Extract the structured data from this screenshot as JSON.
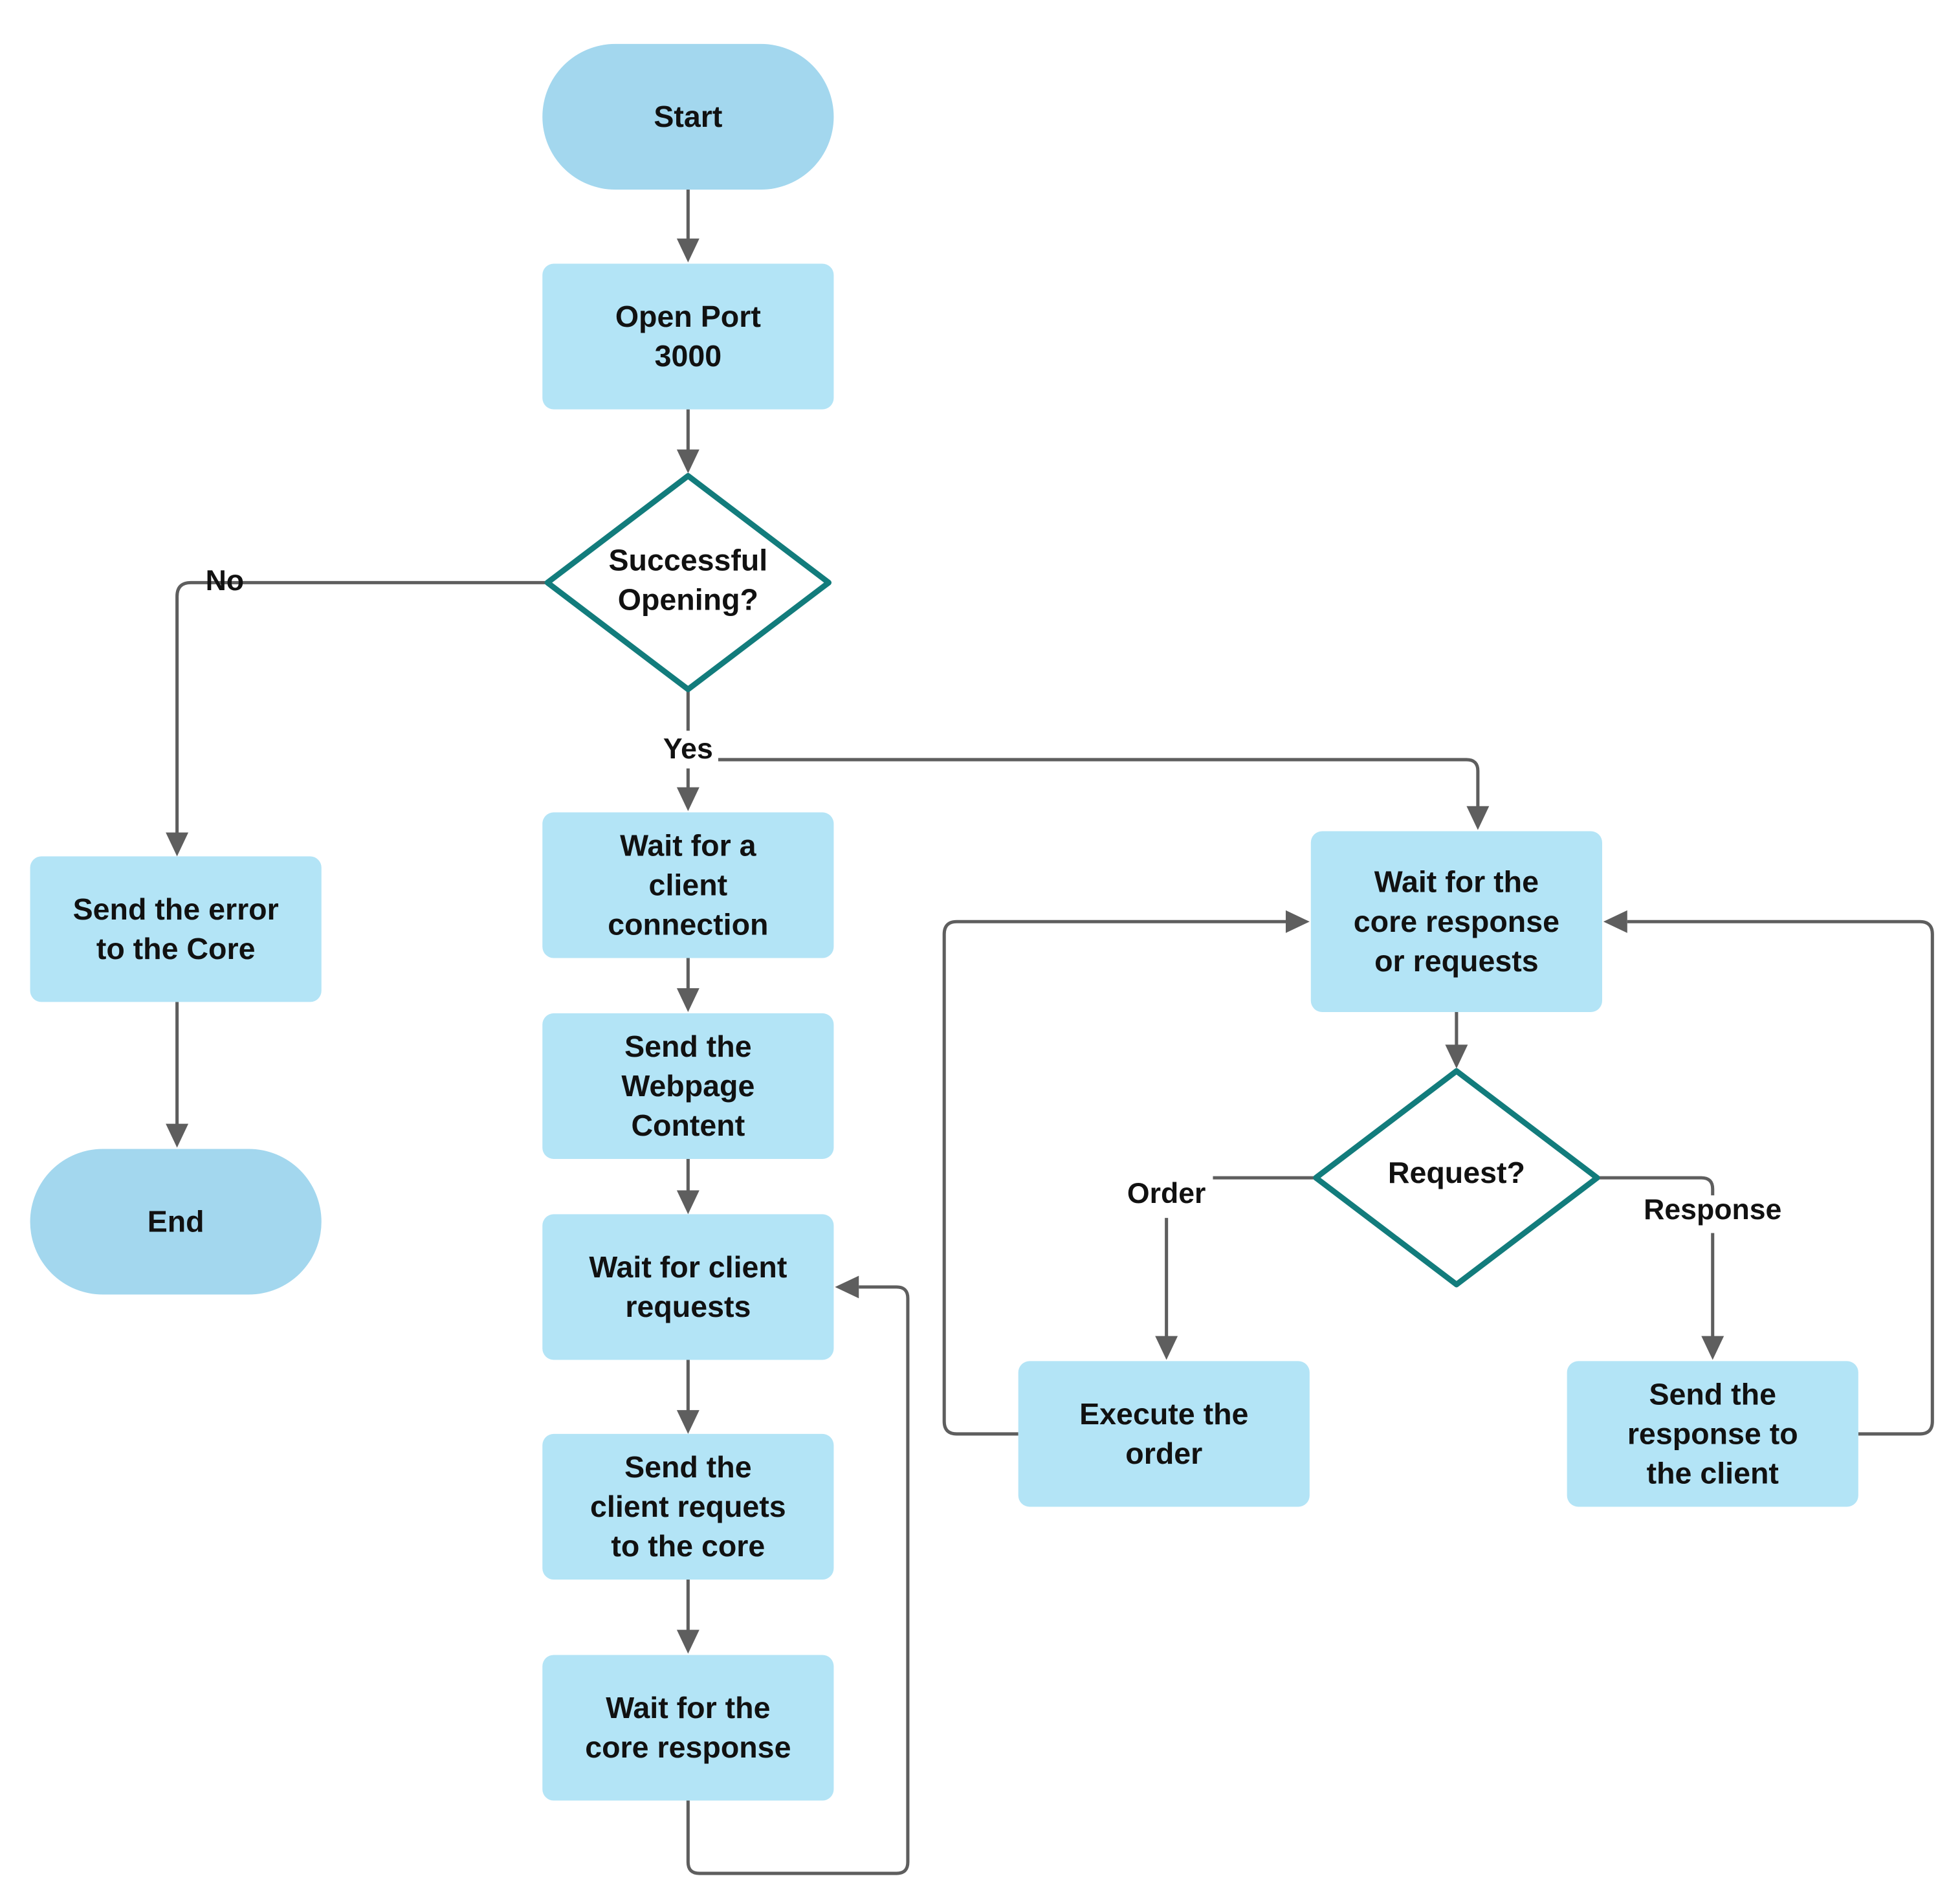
{
  "diagram": {
    "type": "flowchart",
    "colors": {
      "terminal_fill": "#a3d7ee",
      "process_fill": "#b3e4f6",
      "decision_stroke": "#127c7c",
      "decision_fill": "#ffffff",
      "edge": "#5e5e5e",
      "text": "#111111"
    },
    "nodes": [
      {
        "id": "start",
        "kind": "terminal",
        "lines": [
          "Start"
        ]
      },
      {
        "id": "open-port",
        "kind": "process",
        "lines": [
          "Open Port",
          "3000"
        ]
      },
      {
        "id": "successful-opening",
        "kind": "decision",
        "lines": [
          "Successful",
          "Opening?"
        ]
      },
      {
        "id": "send-error",
        "kind": "process",
        "lines": [
          "Send the error",
          "to the Core"
        ]
      },
      {
        "id": "end",
        "kind": "terminal",
        "lines": [
          "End"
        ]
      },
      {
        "id": "wait-client-connection",
        "kind": "process",
        "lines": [
          "Wait for a",
          "client",
          "connection"
        ]
      },
      {
        "id": "send-webpage",
        "kind": "process",
        "lines": [
          "Send the",
          "Webpage",
          "Content"
        ]
      },
      {
        "id": "wait-client-requests",
        "kind": "process",
        "lines": [
          "Wait for client",
          "requests"
        ]
      },
      {
        "id": "send-client-requests",
        "kind": "process",
        "lines": [
          "Send the",
          "client requets",
          "to the core"
        ]
      },
      {
        "id": "wait-core-response",
        "kind": "process",
        "lines": [
          "Wait for the",
          "core response"
        ]
      },
      {
        "id": "wait-core-response-or-requests",
        "kind": "process",
        "lines": [
          "Wait for the",
          "core response",
          "or requests"
        ]
      },
      {
        "id": "request-decision",
        "kind": "decision",
        "lines": [
          "Request?"
        ]
      },
      {
        "id": "execute-order",
        "kind": "process",
        "lines": [
          "Execute the",
          "order"
        ]
      },
      {
        "id": "send-response-client",
        "kind": "process",
        "lines": [
          "Send the",
          "response to",
          "the client"
        ]
      }
    ],
    "edges": [
      {
        "from": "start",
        "to": "open-port",
        "label": ""
      },
      {
        "from": "open-port",
        "to": "successful-opening",
        "label": ""
      },
      {
        "from": "successful-opening",
        "to": "send-error",
        "label": "No"
      },
      {
        "from": "send-error",
        "to": "end",
        "label": ""
      },
      {
        "from": "successful-opening",
        "to": "wait-client-connection",
        "label": "Yes"
      },
      {
        "from": "successful-opening",
        "to": "wait-core-response-or-requests",
        "label": ""
      },
      {
        "from": "wait-client-connection",
        "to": "send-webpage",
        "label": ""
      },
      {
        "from": "send-webpage",
        "to": "wait-client-requests",
        "label": ""
      },
      {
        "from": "wait-client-requests",
        "to": "send-client-requests",
        "label": ""
      },
      {
        "from": "send-client-requests",
        "to": "wait-core-response",
        "label": ""
      },
      {
        "from": "wait-core-response",
        "to": "wait-client-requests",
        "label": ""
      },
      {
        "from": "wait-core-response-or-requests",
        "to": "request-decision",
        "label": ""
      },
      {
        "from": "request-decision",
        "to": "execute-order",
        "label": "Order"
      },
      {
        "from": "request-decision",
        "to": "send-response-client",
        "label": "Response"
      },
      {
        "from": "execute-order",
        "to": "wait-core-response-or-requests",
        "label": ""
      },
      {
        "from": "send-response-client",
        "to": "wait-core-response-or-requests",
        "label": ""
      }
    ]
  }
}
